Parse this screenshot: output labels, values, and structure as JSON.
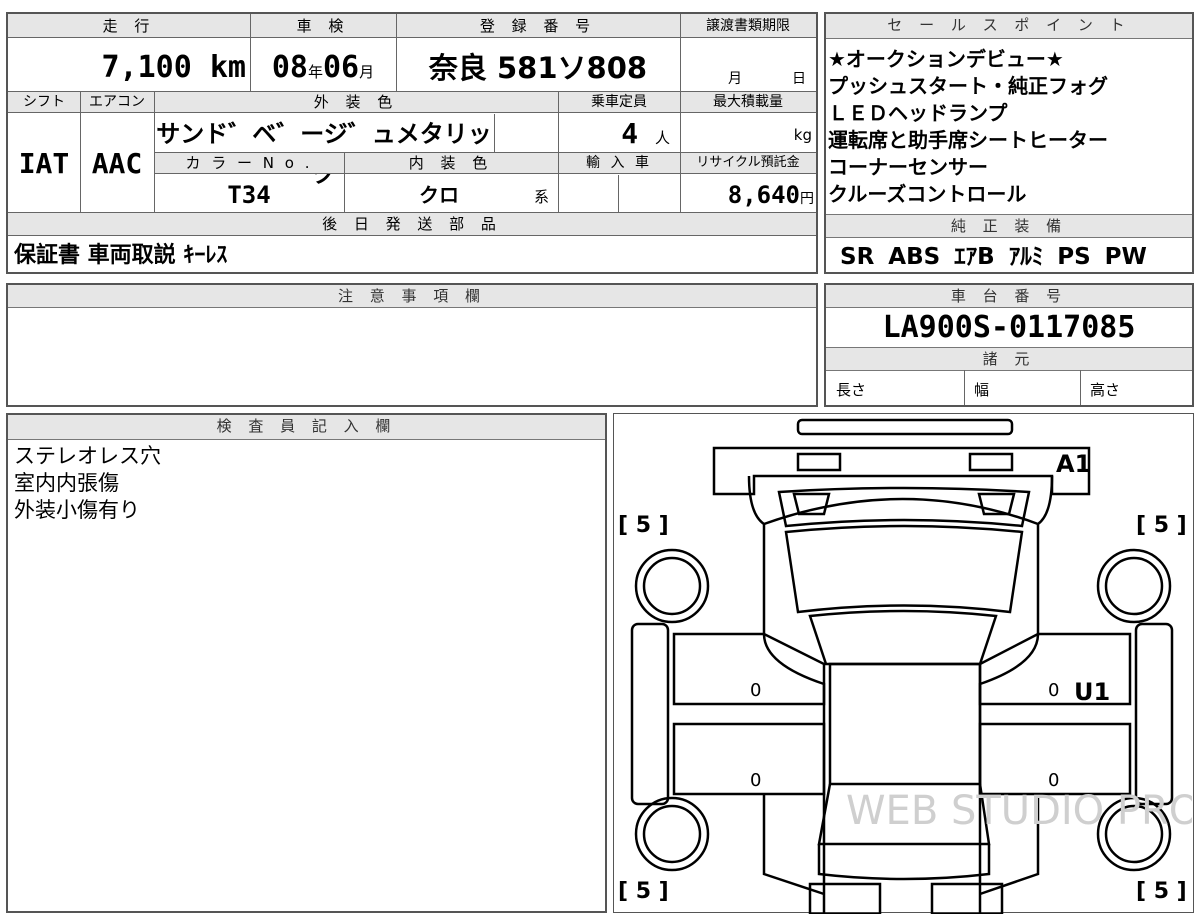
{
  "top_headers": {
    "mileage": "走 行",
    "inspection": "車 検",
    "registration": "登 録 番 号",
    "transfer_deadline": "譲渡書類期限",
    "shift": "シフト",
    "aircon": "エアコン",
    "exterior_color": "外 装 色",
    "capacity": "乗車定員",
    "max_load": "最大積載量",
    "color_no": "カ ラ ー N o .",
    "interior_color": "内 装 色",
    "import": "輸 入 車",
    "recycle_fee": "リサイクル預託金",
    "later_parts": "後 日 発 送 部 品"
  },
  "values": {
    "mileage": "7,100",
    "mileage_unit": "km",
    "inspection_year": "08",
    "year_unit": "年",
    "inspection_month": "06",
    "month_unit": "月",
    "registration": "奈良 581ソ808",
    "deadline_month": "月",
    "deadline_day": "日",
    "shift": "IAT",
    "aircon": "AAC",
    "exterior_color": "サンド゛ベ゛ージ゛ュメタリック",
    "capacity": "4",
    "capacity_unit": "人",
    "max_load_unit": "kg",
    "color_no": "T34",
    "interior_color": "クロ",
    "interior_suffix": "系",
    "recycle_fee": "8,640",
    "recycle_unit": "円",
    "later_parts": "保証書 車両取説 ｷｰﾚｽ"
  },
  "sales_points": {
    "header": "セ ー ル ス ポ イ ン ト",
    "lines": [
      "★オークションデビュー★",
      "プッシュスタート・純正フォグ",
      "ＬＥＤヘッドランプ",
      "運転席と助手席シートヒーター",
      "コーナーセンサー",
      "クルーズコントロール"
    ]
  },
  "equipment": {
    "header": "純 正 装 備",
    "value": "SR ABS ｴｱB ｱﾙﾐ PS PW"
  },
  "notes": {
    "header": "注 意 事 項 欄"
  },
  "chassis": {
    "header": "車 台 番 号",
    "value": "LA900S-0117085",
    "specs_header": "諸 元",
    "length": "長さ",
    "width": "幅",
    "height": "高さ"
  },
  "inspector": {
    "header": "検 査 員 記 入 欄",
    "lines": [
      "ステレオレス穴",
      "室内内張傷",
      "外装小傷有り"
    ]
  },
  "diagram": {
    "tire_labels": [
      "[ 5 ]",
      "[ 5 ]",
      "[ 5 ]",
      "[ 5 ]"
    ],
    "marks": [
      "A1",
      "U1"
    ],
    "zeros": [
      "0",
      "0",
      "0",
      "0"
    ],
    "watermark": "WEB STUDIO PRO"
  }
}
